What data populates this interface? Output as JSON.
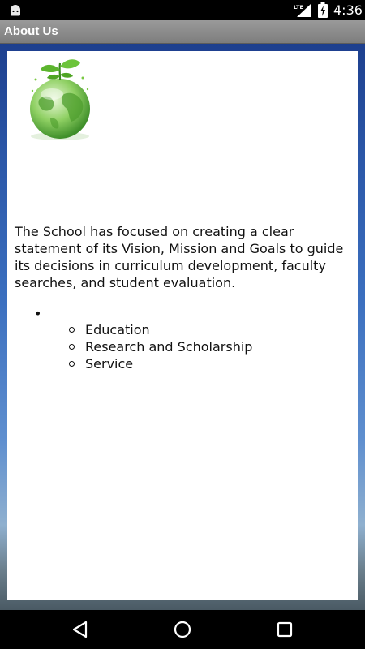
{
  "status_bar": {
    "time": "4:36",
    "network_label": "LTE",
    "icons": [
      "android-icon",
      "lte-signal-icon",
      "battery-charging-icon"
    ]
  },
  "app_bar": {
    "title": "About Us"
  },
  "content": {
    "logo": "globe-plant-icon",
    "intro_text": "The School has focused on creating a clear statement of its Vision, Mission and Goals to guide its decisions in curriculum development, faculty searches, and student evaluation.",
    "outer_bullet": "•",
    "goals": [
      "Education",
      "Research and Scholarship",
      "Service"
    ]
  },
  "nav_bar": {
    "buttons": [
      "back-icon",
      "home-icon",
      "recents-icon"
    ]
  },
  "colors": {
    "title_bar": "#8c8c8c",
    "background_top": "#1d3f8e",
    "card": "#ffffff"
  }
}
